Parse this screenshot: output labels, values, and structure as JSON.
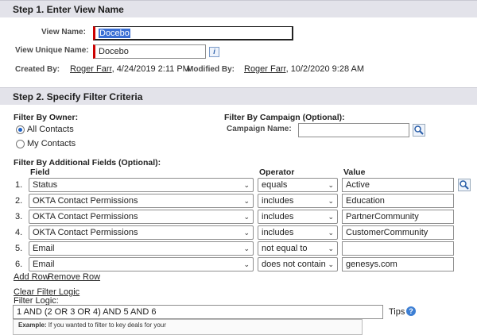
{
  "step1": {
    "header": "Step 1. Enter View Name",
    "view_name_label": "View Name:",
    "view_name_value": "Docebo",
    "view_unique_label": "View Unique Name:",
    "view_unique_value": "Docebo",
    "info_icon": "i",
    "created_by_label": "Created By:",
    "created_by_user": "Roger Farr",
    "created_by_date": ", 4/24/2019 2:11 PM",
    "modified_by_label": "Modified By:",
    "modified_by_user": "Roger Farr",
    "modified_by_date": ", 10/2/2020 9:28 AM"
  },
  "step2": {
    "header": "Step 2. Specify Filter Criteria",
    "owner_label": "Filter By Owner:",
    "owner_options": [
      "All Contacts",
      "My Contacts"
    ],
    "owner_selected": "All Contacts",
    "campaign_label": "Filter By Campaign (Optional):",
    "campaign_name_label": "Campaign Name:",
    "campaign_name_value": "",
    "fields_label": "Filter By Additional Fields (Optional):",
    "col_field": "Field",
    "col_operator": "Operator",
    "col_value": "Value",
    "rows": [
      {
        "num": "1.",
        "field": "Status",
        "operator": "equals",
        "value": "Active"
      },
      {
        "num": "2.",
        "field": "OKTA Contact Permissions",
        "operator": "includes",
        "value": "Education"
      },
      {
        "num": "3.",
        "field": "OKTA Contact Permissions",
        "operator": "includes",
        "value": "PartnerCommunity"
      },
      {
        "num": "4.",
        "field": "OKTA Contact Permissions",
        "operator": "includes",
        "value": "CustomerCommunity"
      },
      {
        "num": "5.",
        "field": "Email",
        "operator": "not equal to",
        "value": ""
      },
      {
        "num": "6.",
        "field": "Email",
        "operator": "does not contain",
        "value": "genesys.com"
      }
    ],
    "add_row": "Add Row",
    "remove_row": "Remove Row",
    "clear_filter_logic": "Clear Filter Logic",
    "filter_logic_label": "Filter Logic:",
    "filter_logic_value": "1 AND (2 OR 3 OR 4) AND 5 AND 6",
    "tips": "Tips",
    "help_icon": "?",
    "example_label": "Example:",
    "example_text": " If you wanted to filter to key deals for your"
  },
  "colors": {
    "required": "#cc0000",
    "header_bg": "#e3e3ea",
    "radio": "#1f63c8"
  }
}
